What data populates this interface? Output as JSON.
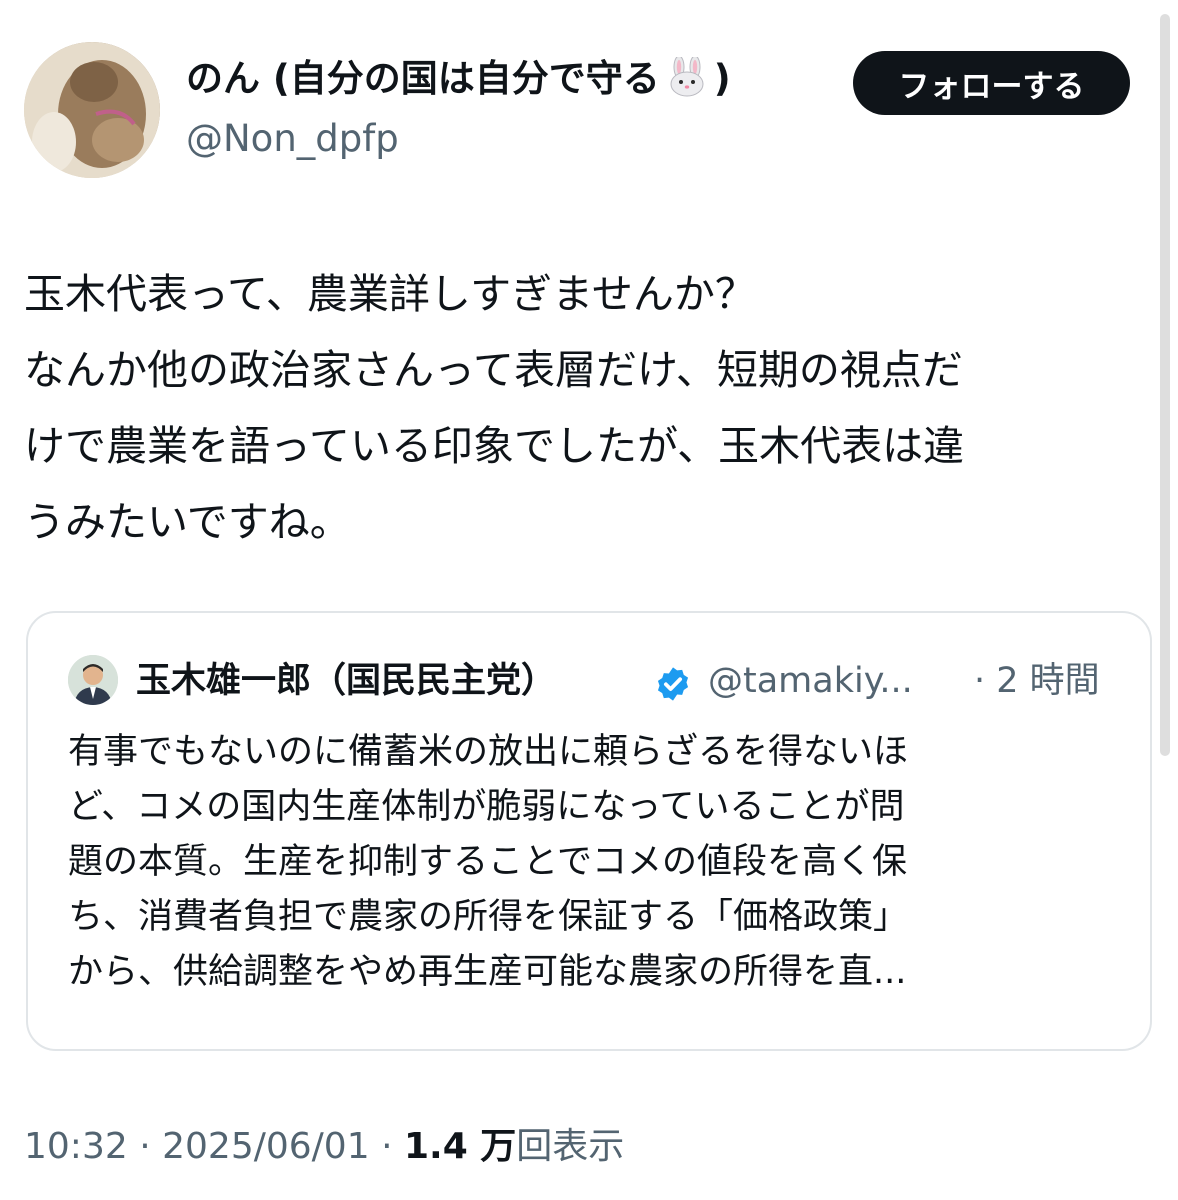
{
  "tweet": {
    "author": {
      "display_name": "のん (自分の国は自分で守る",
      "display_name_emoji": "rabbit-face-emoji",
      "display_name_end": ")",
      "handle": "@Non_dpfp"
    },
    "follow_label": "フォローする",
    "body_lines": [
      "玉木代表って、農業詳しすぎませんか？",
      "なんか他の政治家さんって表層だけ、短期の視点だ",
      "けで農業を語っている印象でしたが、玉木代表は違",
      "うみたいですね。"
    ],
    "quote": {
      "display_name": "玉木雄一郎（国民民主党）",
      "verified_icon": "verified-badge-icon",
      "handle": "@tamakiy...",
      "separator": "·",
      "time": "2 時間",
      "text_lines": [
        "有事でもないのに備蓄米の放出に頼らざるを得ないほ",
        "ど、コメの国内生産体制が脆弱になっていることが問",
        "題の本質。生産を抑制することでコメの値段を高く保",
        "ち、消費者負担で農家の所得を保証する「価格政策」",
        "から、供給調整をやめ再生産可能な農家の所得を直..."
      ]
    },
    "meta": {
      "time": "10:32",
      "date": "2025/06/01",
      "views_count": "1.4 万",
      "views_label": "回表示",
      "separator": "·"
    },
    "colors": {
      "text": "#0f1419",
      "secondary": "#536471",
      "verified": "#1d9bf0",
      "border": "#e1e5e8"
    }
  }
}
